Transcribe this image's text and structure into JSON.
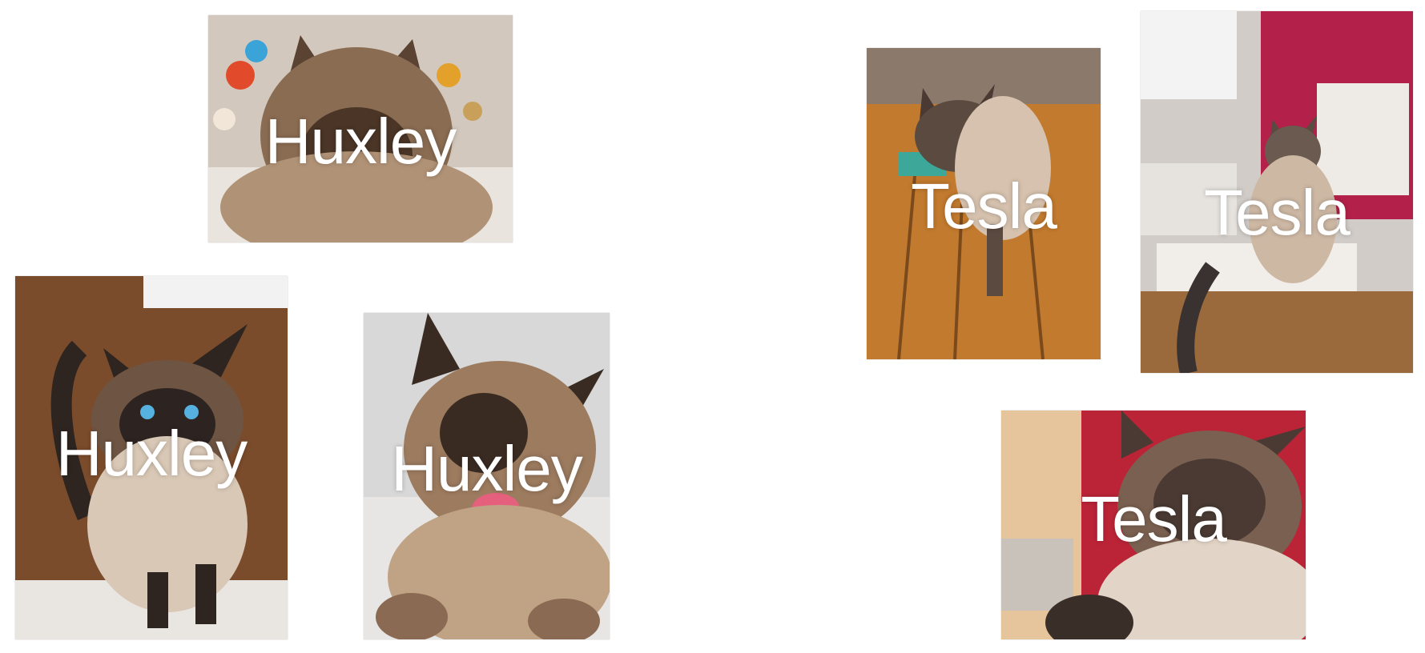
{
  "photos": [
    {
      "id": "huxley-1",
      "caption": "Huxley"
    },
    {
      "id": "huxley-2",
      "caption": "Huxley"
    },
    {
      "id": "huxley-3",
      "caption": "Huxley"
    },
    {
      "id": "tesla-1",
      "caption": "Tesla"
    },
    {
      "id": "tesla-2",
      "caption": "Tesla"
    },
    {
      "id": "tesla-3",
      "caption": "Tesla"
    }
  ],
  "colors": {
    "background": "#ffffff",
    "caption": "#ffffff"
  }
}
